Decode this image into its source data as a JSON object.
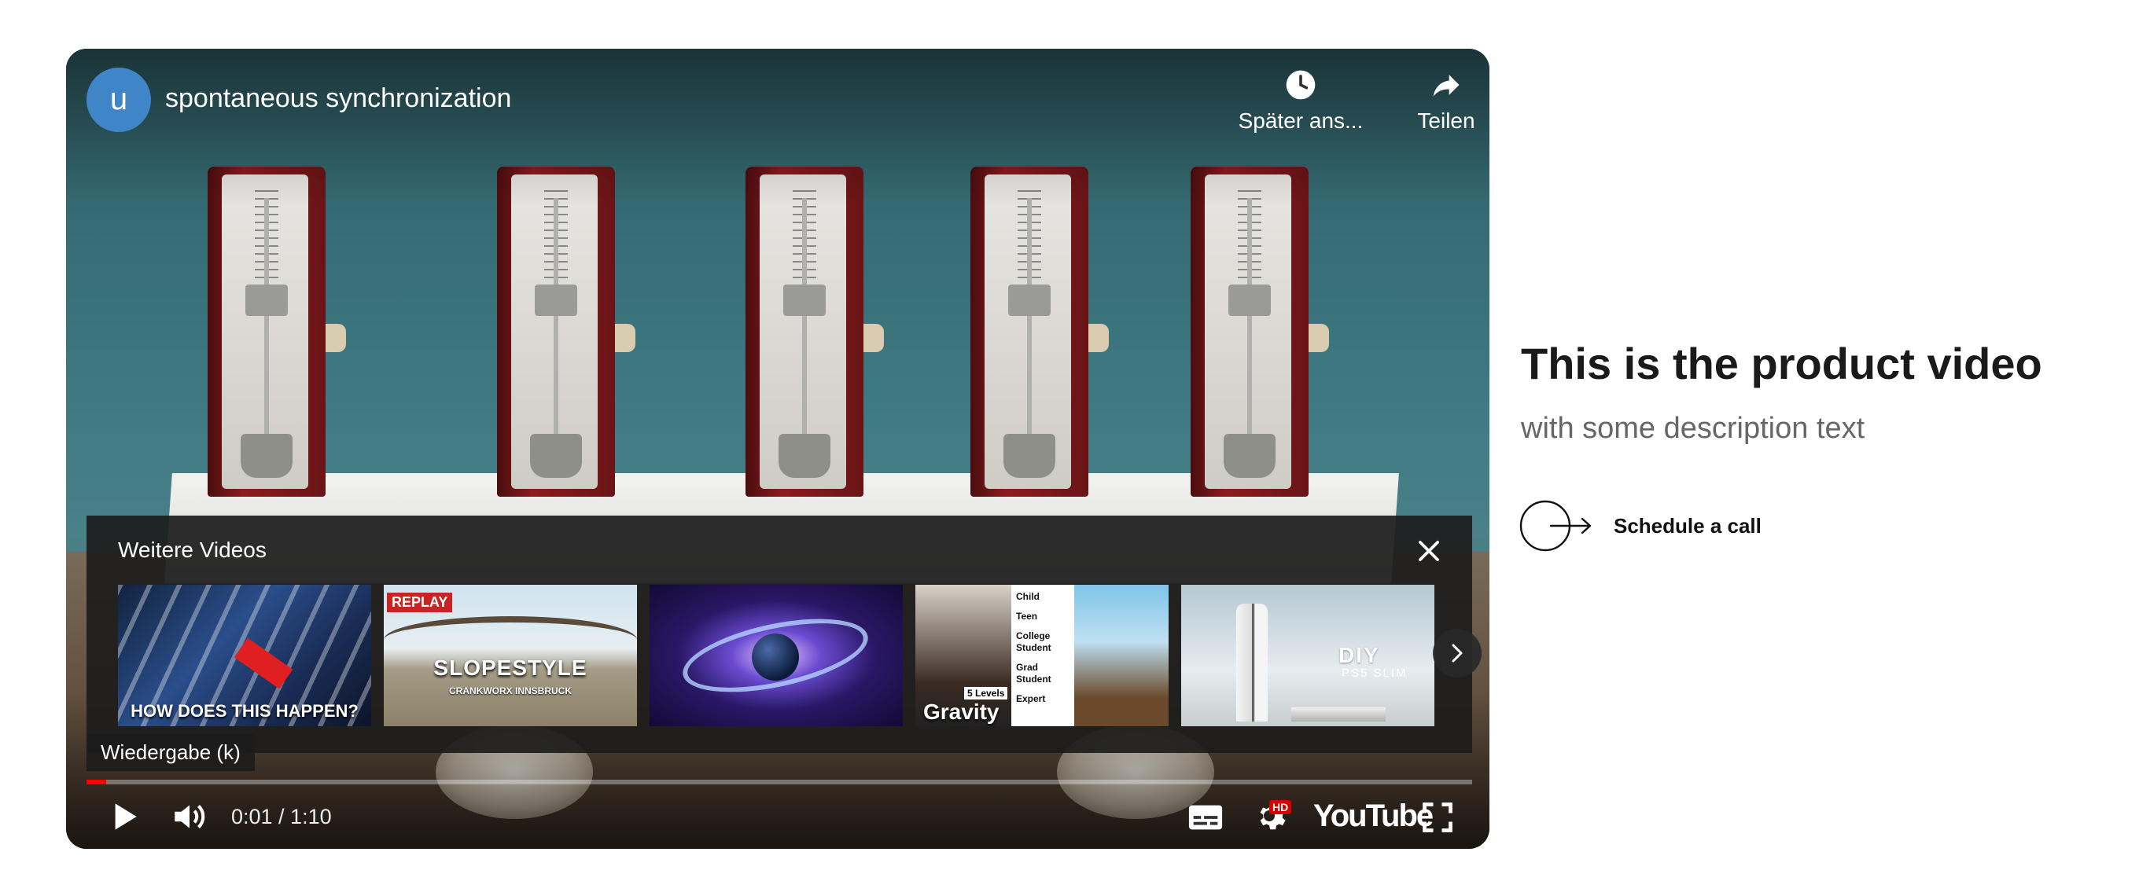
{
  "player": {
    "channel_initial": "u",
    "title": "spontaneous synchronization",
    "watch_later_label": "Später ans...",
    "share_label": "Teilen",
    "more_videos": {
      "title": "Weitere Videos",
      "thumbnails": [
        {
          "caption": "HOW DOES THIS HAPPEN?"
        },
        {
          "badge": "REPLAY",
          "caption": "SLOPESTYLE",
          "subcaption": "CRANKWORX INNSBRUCK"
        },
        {
          "caption": ""
        },
        {
          "levels_badge": "5 Levels",
          "caption": "Gravity",
          "levels": [
            "Child",
            "Teen",
            "College Student",
            "Grad Student",
            "Expert"
          ]
        },
        {
          "caption": "DIY",
          "subcaption": "PS5 SLIM"
        }
      ]
    },
    "tooltip": "Wiedergabe (k)",
    "progress": 0.014,
    "time_display": "0:01 / 1:10",
    "hd_badge": "HD",
    "logo_text": "YouTube",
    "accent_color": "#ff0000"
  },
  "content": {
    "heading": "This is the product video",
    "description": "with some description text",
    "cta_label": "Schedule a call"
  }
}
